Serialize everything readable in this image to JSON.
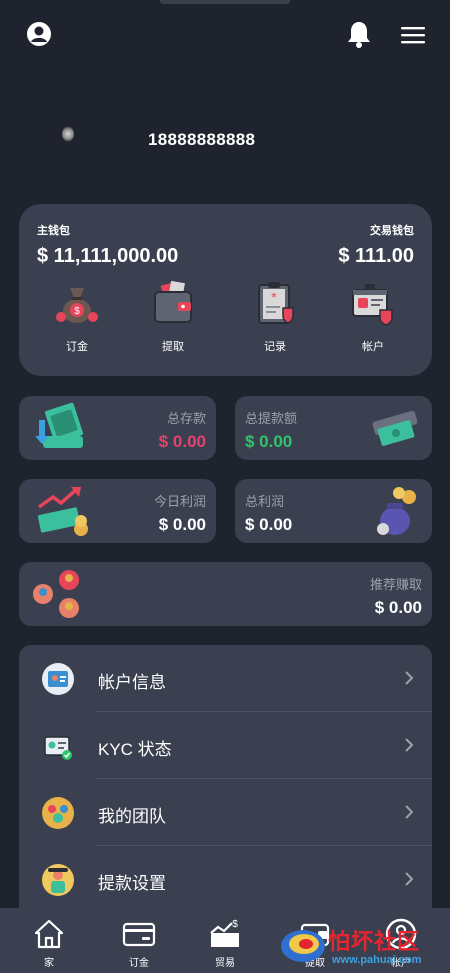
{
  "header": {
    "username": "18888888888"
  },
  "wallet": {
    "main_label": "主钱包",
    "main_amount": "$ 11,111,000.00",
    "trade_label": "交易钱包",
    "trade_amount": "$ 111.00",
    "actions": [
      {
        "label": "订金",
        "icon": "money-bag-icon"
      },
      {
        "label": "提取",
        "icon": "wallet-icon"
      },
      {
        "label": "记录",
        "icon": "clipboard-icon"
      },
      {
        "label": "帐户",
        "icon": "account-card-icon"
      }
    ]
  },
  "stats": {
    "total_deposit_title": "总存款",
    "total_deposit_value": "$ 0.00",
    "total_withdraw_title": "总提款额",
    "total_withdraw_value": "$ 0.00",
    "today_profit_title": "今日利润",
    "today_profit_value": "$ 0.00",
    "total_profit_title": "总利润",
    "total_profit_value": "$ 0.00",
    "referral_title": "推荐赚取",
    "referral_value": "$ 0.00"
  },
  "menu": {
    "items": [
      {
        "label": "帐户信息",
        "icon": "profile-card-icon"
      },
      {
        "label": "KYC 状态",
        "icon": "id-badge-icon"
      },
      {
        "label": "我的团队",
        "icon": "team-icon"
      },
      {
        "label": "提款设置",
        "icon": "settings-person-icon"
      }
    ]
  },
  "bottom_nav": {
    "items": [
      {
        "label": "家",
        "icon": "home-icon"
      },
      {
        "label": "订金",
        "icon": "card-icon"
      },
      {
        "label": "贸易",
        "icon": "trade-icon"
      },
      {
        "label": "提取",
        "icon": "withdraw-icon"
      },
      {
        "label": "帐户",
        "icon": "user-circle-icon"
      }
    ]
  },
  "watermark": {
    "text": "怕坏社区",
    "url": "www.pahuai.com"
  },
  "colors": {
    "background": "#1f232e",
    "card": "#3b4050",
    "deposit_pink": "#e8406d",
    "withdraw_green": "#2ec66a"
  }
}
